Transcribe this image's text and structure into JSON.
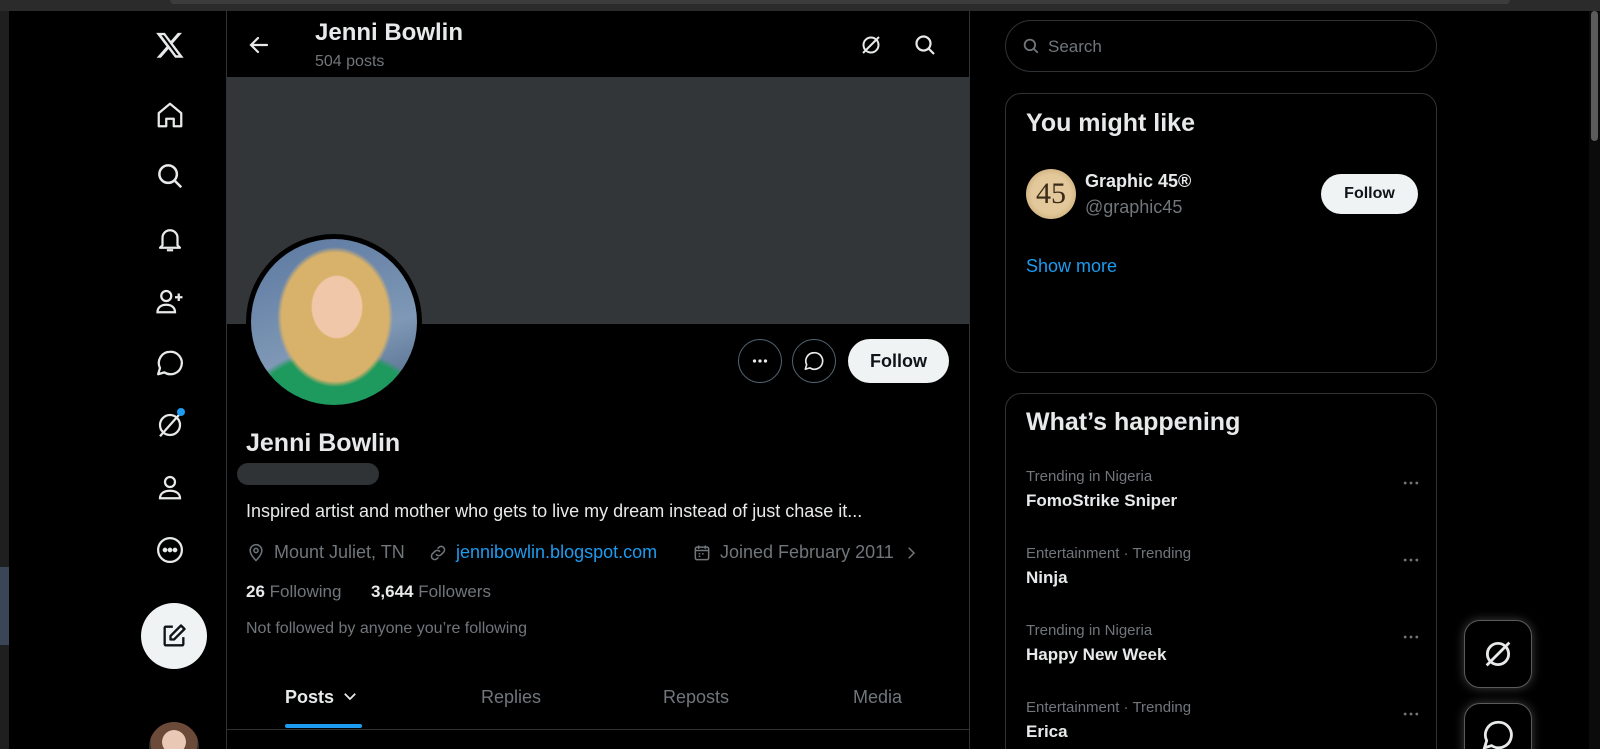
{
  "header": {
    "name": "Jenni Bowlin",
    "post_count": "504 posts"
  },
  "profile": {
    "name": "Jenni Bowlin",
    "bio": "Inspired artist and mother who gets to live my dream instead of just chase it...",
    "location": "Mount Juliet, TN",
    "website": "jennibowlin.blogspot.com",
    "joined": "Joined February 2011",
    "following_count": "26",
    "following_label": "Following",
    "followers_count": "3,644",
    "followers_label": "Followers",
    "not_followed": "Not followed by anyone you’re following",
    "follow_label": "Follow"
  },
  "tabs": [
    {
      "label": "Posts",
      "active": true
    },
    {
      "label": "Replies",
      "active": false
    },
    {
      "label": "Reposts",
      "active": false
    },
    {
      "label": "Media",
      "active": false
    }
  ],
  "search": {
    "placeholder": "Search"
  },
  "you_might_like": {
    "title": "You might like",
    "suggestion": {
      "name": "Graphic 45®",
      "handle": "@graphic45",
      "avatar_text": "45",
      "follow_label": "Follow"
    },
    "show_more": "Show more"
  },
  "whats_happening": {
    "title": "What’s happening",
    "trends": [
      {
        "context": "Trending in Nigeria",
        "name": "FomoStrike Sniper"
      },
      {
        "context": "Entertainment · Trending",
        "name": "Ninja"
      },
      {
        "context": "Trending in Nigeria",
        "name": "Happy New Week"
      },
      {
        "context": "Entertainment · Trending",
        "name": "Erica"
      }
    ]
  },
  "colors": {
    "background": "#000000",
    "accent": "#1d9bf0",
    "text_primary": "#e7e9ea",
    "text_secondary": "#71767b",
    "border": "#2f3336"
  },
  "icons": {
    "nav": [
      "x-logo-icon",
      "home-icon",
      "search-icon",
      "bell-icon",
      "add-user-icon",
      "message-icon",
      "grok-icon",
      "profile-icon",
      "more-circle-icon",
      "compose-icon"
    ]
  }
}
